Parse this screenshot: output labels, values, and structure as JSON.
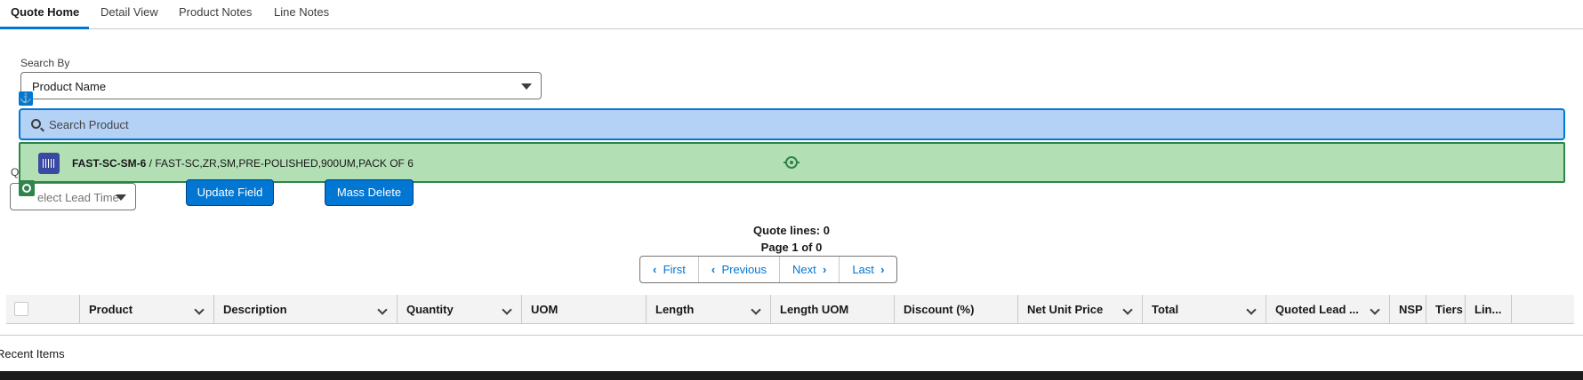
{
  "tabs": [
    {
      "label": "Quote Home",
      "active": true
    },
    {
      "label": "Detail View"
    },
    {
      "label": "Product Notes"
    },
    {
      "label": "Line Notes"
    }
  ],
  "search_by": {
    "label": "Search By",
    "selected": "Product Name"
  },
  "search": {
    "placeholder": "Search Product"
  },
  "result": {
    "code": "FAST-SC-SM-6",
    "separator": " / ",
    "description": "FAST-SC,ZR,SM,PRE-POLISHED,900UM,PACK OF 6"
  },
  "lead_time": {
    "label_fragment": "Q",
    "placeholder": "Select Lead Time",
    "visible_text": "elect Lead Time"
  },
  "buttons": {
    "update_field": "Update Field",
    "mass_delete": "Mass Delete"
  },
  "summary": {
    "quote_lines": "Quote lines: 0",
    "page_info": "Page 1 of 0"
  },
  "pager": {
    "first": "First",
    "previous": "Previous",
    "next": "Next",
    "last": "Last"
  },
  "columns": [
    {
      "label": "Product",
      "dropdown": true
    },
    {
      "label": "Description",
      "dropdown": true
    },
    {
      "label": "Quantity",
      "dropdown": true
    },
    {
      "label": "UOM",
      "dropdown": false
    },
    {
      "label": "Length",
      "dropdown": true
    },
    {
      "label": "Length UOM",
      "dropdown": false
    },
    {
      "label": "Discount (%)",
      "dropdown": false
    },
    {
      "label": "Net Unit Price",
      "dropdown": true
    },
    {
      "label": "Total",
      "dropdown": true
    },
    {
      "label": "Quoted Lead ...",
      "dropdown": true
    },
    {
      "label": "NSP",
      "dropdown": false
    },
    {
      "label": "Tiers",
      "dropdown": false
    },
    {
      "label": "Lin...",
      "dropdown": false
    }
  ],
  "footer": {
    "recent_items": "Recent Items"
  },
  "colors": {
    "brand": "#0176d3",
    "highlight_blue": "#b4d2f6",
    "highlight_green": "#b3dfb5",
    "green_border": "#2e844a"
  },
  "icons": [
    "anchor-icon",
    "search-icon",
    "barcode-icon",
    "target-icon",
    "chevron-left-icon",
    "chevron-right-icon",
    "chevron-down-icon"
  ]
}
